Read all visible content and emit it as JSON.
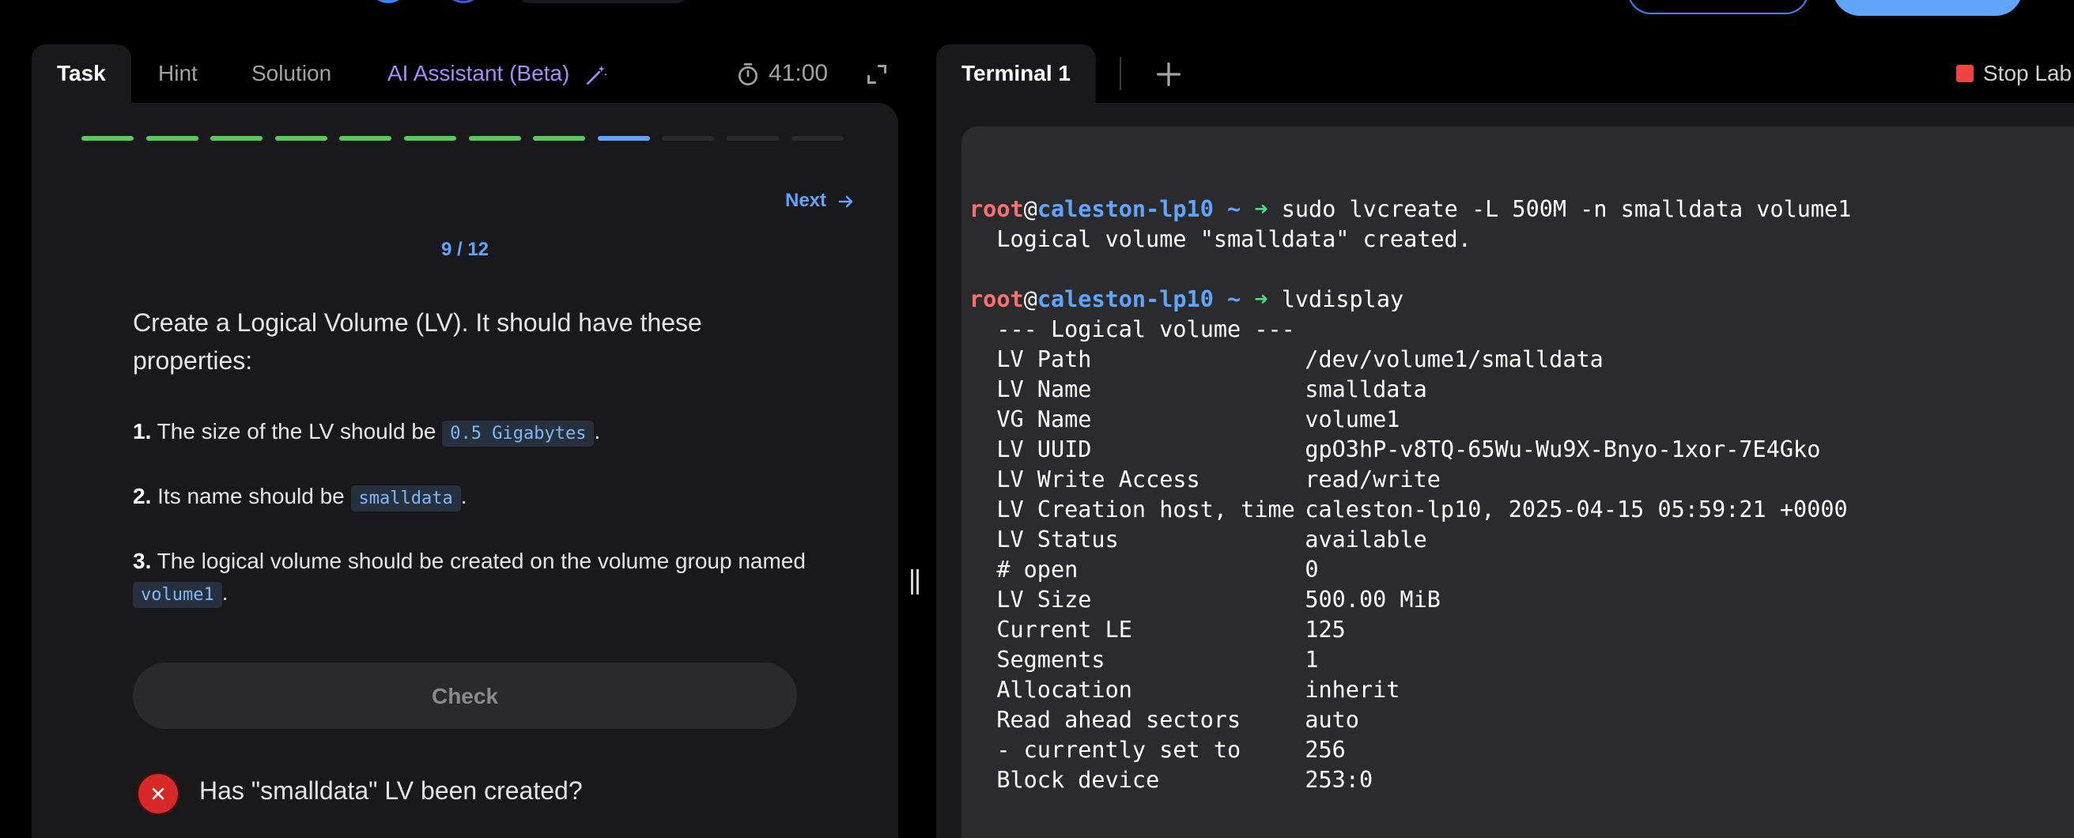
{
  "tabs": [
    {
      "label": "Task",
      "active": true
    },
    {
      "label": "Hint"
    },
    {
      "label": "Solution"
    },
    {
      "label": "AI Assistant (Beta)"
    }
  ],
  "timer": "41:00",
  "progress": {
    "total": 12,
    "completed": 8,
    "current": 9
  },
  "nav": {
    "next_label": "Next",
    "counter": "9 / 12"
  },
  "task": {
    "description": "Create a Logical Volume (LV). It should have these properties:",
    "items": [
      {
        "num": "1.",
        "pre": "The size of the LV should be",
        "code": "0.5 Gigabytes",
        "post": "."
      },
      {
        "num": "2.",
        "pre": "Its name should be",
        "code": "smalldata",
        "post": "."
      },
      {
        "num": "3.",
        "pre": "The logical volume should be created on the volume group named",
        "code": "volume1",
        "post": "."
      }
    ],
    "check_label": "Check",
    "result_text": "Has \"smalldata\" LV been created?"
  },
  "terminal": {
    "tab_label": "Terminal 1",
    "stop_label": "Stop Lab",
    "prompt": {
      "user": "root",
      "at": "@",
      "host": "caleston-lp10",
      "dir": "~",
      "arrow": "➜"
    },
    "cmd1": "sudo lvcreate -L 500M -n smalldata volume1",
    "out1": "  Logical volume \"smalldata\" created.",
    "cmd2": "lvdisplay",
    "lv_header": "  --- Logical volume ---",
    "lv_rows": [
      {
        "k": "LV Path",
        "v": "/dev/volume1/smalldata"
      },
      {
        "k": "LV Name",
        "v": "smalldata"
      },
      {
        "k": "VG Name",
        "v": "volume1"
      },
      {
        "k": "LV UUID",
        "v": "gpO3hP-v8TQ-65Wu-Wu9X-Bnyo-1xor-7E4Gko"
      },
      {
        "k": "LV Write Access",
        "v": "read/write"
      },
      {
        "k": "LV Creation host, time",
        "v": "caleston-lp10, 2025-04-15 05:59:21 +0000"
      },
      {
        "k": "LV Status",
        "v": "available"
      },
      {
        "k": "# open",
        "v": "0"
      },
      {
        "k": "LV Size",
        "v": "500.00 MiB"
      },
      {
        "k": "Current LE",
        "v": "125"
      },
      {
        "k": "Segments",
        "v": "1"
      },
      {
        "k": "Allocation",
        "v": "inherit"
      },
      {
        "k": "Read ahead sectors",
        "v": "auto"
      },
      {
        "k": "- currently set to",
        "v": "256"
      },
      {
        "k": "Block device",
        "v": "253:0"
      }
    ]
  },
  "colors": {
    "done": "#5bc85b",
    "current": "#60a5fa",
    "pending": "#2a2a2c"
  }
}
